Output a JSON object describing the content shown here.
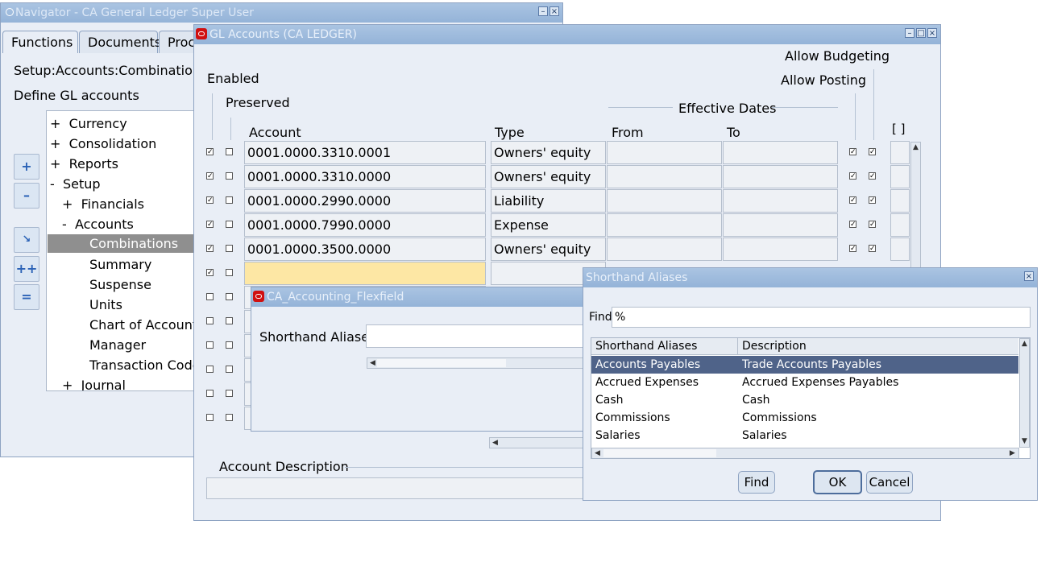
{
  "navigator": {
    "title": "Navigator - CA General Ledger Super User",
    "tabs": [
      "Functions",
      "Documents",
      "Proc"
    ],
    "path": "Setup:Accounts:Combinations",
    "description": "Define GL accounts",
    "tree": [
      {
        "prefix": "+",
        "label": "Currency"
      },
      {
        "prefix": "+",
        "label": "Consolidation"
      },
      {
        "prefix": "+",
        "label": "Reports"
      },
      {
        "prefix": "-",
        "label": "Setup"
      },
      {
        "prefix": "+",
        "label": "Financials"
      },
      {
        "prefix": "-",
        "label": "Accounts"
      },
      {
        "prefix": "",
        "label": "Combinations"
      },
      {
        "prefix": "",
        "label": "Summary"
      },
      {
        "prefix": "",
        "label": "Suspense"
      },
      {
        "prefix": "",
        "label": "Units"
      },
      {
        "prefix": "",
        "label": "Chart of Accounts"
      },
      {
        "prefix": "",
        "label": "Manager"
      },
      {
        "prefix": "",
        "label": "Transaction Code"
      },
      {
        "prefix": "+",
        "label": "Journal"
      }
    ]
  },
  "gl": {
    "title": "GL Accounts (CA LEDGER)",
    "labels": {
      "enabled": "Enabled",
      "preserved": "Preserved",
      "account": "Account",
      "type": "Type",
      "effective_dates": "Effective Dates",
      "from": "From",
      "to": "To",
      "allow_budgeting": "Allow Budgeting",
      "allow_posting": "Allow Posting",
      "brackets": "[ ]",
      "account_description": "Account Description"
    },
    "rows": [
      {
        "enabled": true,
        "preserved": false,
        "account": "0001.0000.3310.0001",
        "type": "Owners' equity",
        "budget": true,
        "posting": true
      },
      {
        "enabled": true,
        "preserved": false,
        "account": "0001.0000.3310.0000",
        "type": "Owners' equity",
        "budget": true,
        "posting": true
      },
      {
        "enabled": true,
        "preserved": false,
        "account": "0001.0000.2990.0000",
        "type": "Liability",
        "budget": true,
        "posting": true
      },
      {
        "enabled": true,
        "preserved": false,
        "account": "0001.0000.7990.0000",
        "type": "Expense",
        "budget": true,
        "posting": true
      },
      {
        "enabled": true,
        "preserved": false,
        "account": "0001.0000.3500.0000",
        "type": "Owners' equity",
        "budget": true,
        "posting": true
      },
      {
        "enabled": true,
        "preserved": false,
        "account": "",
        "type": "",
        "budget": false,
        "posting": false
      },
      {
        "enabled": false,
        "preserved": false
      },
      {
        "enabled": false,
        "preserved": false
      },
      {
        "enabled": false,
        "preserved": false
      },
      {
        "enabled": false,
        "preserved": false
      },
      {
        "enabled": false,
        "preserved": false
      },
      {
        "enabled": false,
        "preserved": false
      }
    ]
  },
  "flexfield": {
    "title": "CA_Accounting_Flexfield",
    "label": "Shorthand Aliases"
  },
  "aliases": {
    "title": "Shorthand Aliases",
    "find_label": "Find",
    "find_value": "%",
    "columns": [
      "Shorthand Aliases",
      "Description"
    ],
    "rows": [
      [
        "Accounts Payables",
        "Trade Accounts Payables"
      ],
      [
        "Accrued Expenses",
        "Accrued Expenses Payables"
      ],
      [
        "Cash",
        "Cash"
      ],
      [
        "Commissions",
        "Commissions"
      ],
      [
        "Salaries",
        "Salaries"
      ]
    ],
    "buttons": {
      "find": "Find",
      "ok": "OK",
      "cancel": "Cancel"
    }
  }
}
